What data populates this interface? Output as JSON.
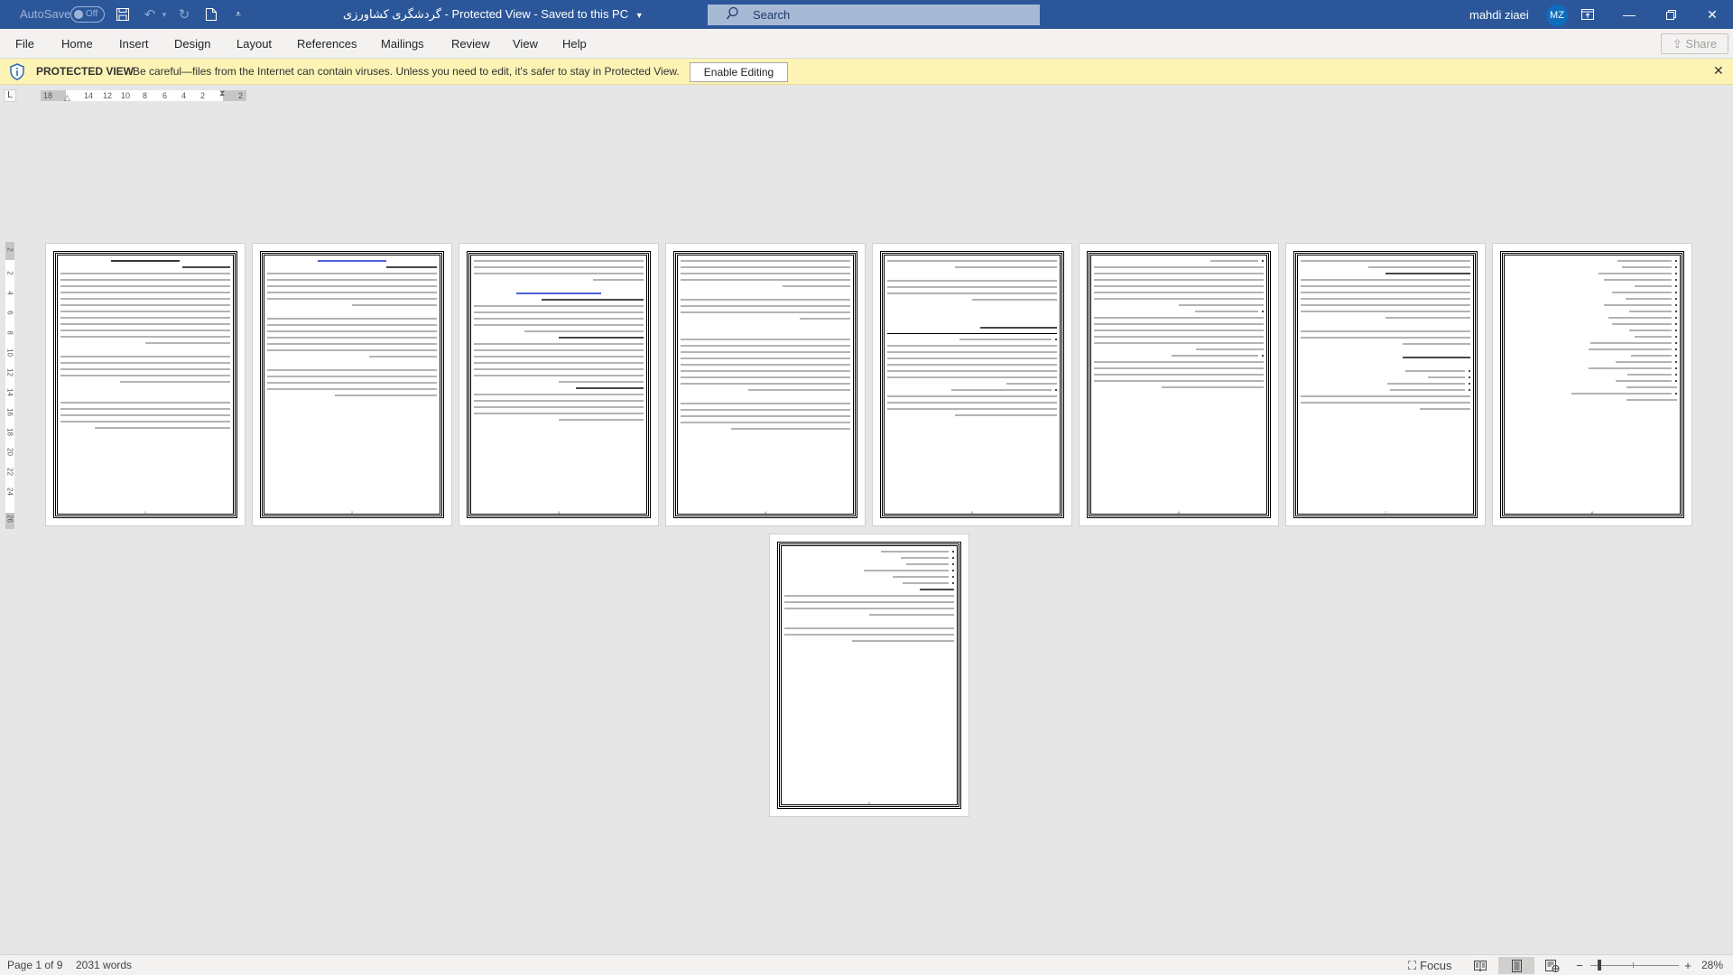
{
  "titlebar": {
    "autosave_label": "AutoSave",
    "autosave_state": "Off",
    "icons": [
      "save-icon",
      "undo-icon",
      "redo-icon",
      "new-document-icon",
      "customize-toolbar-icon"
    ],
    "doc_name": "گردشگری کشاورزی",
    "separator": " - ",
    "view_mode": "Protected View",
    "save_status": "Saved to this PC",
    "search_placeholder": "Search",
    "user_name": "mahdi ziaei",
    "user_initials": "MZ",
    "window_controls": [
      "ribbon-display-options",
      "minimize",
      "restore",
      "close"
    ]
  },
  "ribbon": {
    "tabs": [
      "File",
      "Home",
      "Insert",
      "Design",
      "Layout",
      "References",
      "Mailings",
      "Review",
      "View",
      "Help"
    ],
    "share_label": "Share"
  },
  "protected_bar": {
    "title": "PROTECTED VIEW",
    "message": "Be careful—files from the Internet can contain viruses. Unless you need to edit, it's safer to stay in Protected View.",
    "enable_label": "Enable Editing",
    "close_glyph": "✕"
  },
  "ruler": {
    "horizontal_labels": [
      "18",
      "14",
      "12",
      "10",
      "8",
      "6",
      "4",
      "2",
      "2"
    ],
    "vertical_labels": [
      "2",
      "2",
      "4",
      "6",
      "8",
      "10",
      "12",
      "14",
      "16",
      "18",
      "20",
      "22",
      "24",
      "26"
    ],
    "tab_selector_glyph": "L"
  },
  "document": {
    "page_count": 9,
    "language": "Persian (RTL)",
    "pages": [
      {
        "number": "1",
        "title": "گردشگری کشاورزی",
        "subtitle": "بحران ناپایداری"
      },
      {
        "number": "2",
        "title": "ایده های گردشگری کشاورزی",
        "subtitle": "گردشگری روستایی"
      },
      {
        "number": "3"
      },
      {
        "number": "4"
      },
      {
        "number": "5",
        "heading": "انواع مزارع اگروتوریسم"
      },
      {
        "number": "6"
      },
      {
        "number": "7"
      },
      {
        "number": "8"
      },
      {
        "number": "9",
        "heading": "جمع بندی"
      }
    ]
  },
  "statusbar": {
    "page_info": "Page 1 of 9",
    "word_count": "2031 words",
    "focus_label": "Focus",
    "zoom_level": "28%",
    "zoom_percent": 28,
    "active_view": "Print Layout"
  }
}
